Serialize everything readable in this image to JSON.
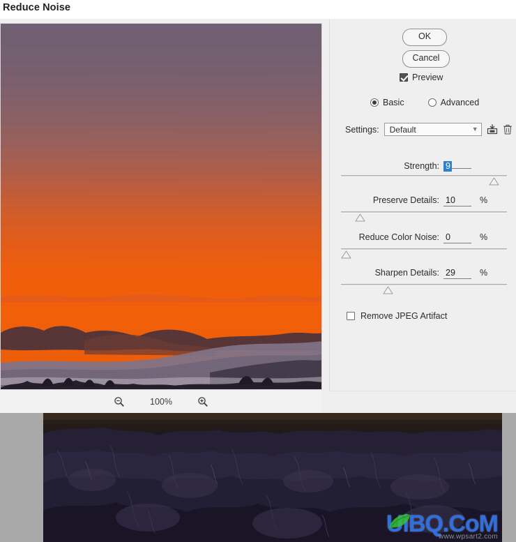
{
  "dialog": {
    "title": "Reduce Noise",
    "ok_label": "OK",
    "cancel_label": "Cancel",
    "preview_label": "Preview",
    "preview_checked": true,
    "mode": {
      "basic_label": "Basic",
      "advanced_label": "Advanced",
      "selected": "Basic"
    },
    "settings": {
      "label": "Settings:",
      "value": "Default",
      "chevron": "chevron-down-icon",
      "save_icon": "save-preset-icon",
      "delete_icon": "delete-preset-icon"
    },
    "sliders": [
      {
        "name": "Strength:",
        "value": "9",
        "unit": "",
        "selected": true,
        "handle_pct": 95
      },
      {
        "name": "Preserve Details:",
        "value": "10",
        "unit": "%",
        "selected": false,
        "handle_pct": 9
      },
      {
        "name": "Reduce Color Noise:",
        "value": "0",
        "unit": "%",
        "selected": false,
        "handle_pct": 0
      },
      {
        "name": "Sharpen Details:",
        "value": "29",
        "unit": "%",
        "selected": false,
        "handle_pct": 27
      }
    ],
    "jpeg": {
      "label": "Remove JPEG Artifact",
      "checked": false
    },
    "zoom": {
      "out_icon": "zoom-out-icon",
      "level": "100%",
      "in_icon": "zoom-in-icon"
    }
  },
  "watermark": {
    "main": "UiBQ.CoM",
    "sub": "www.wpsart2.com"
  }
}
